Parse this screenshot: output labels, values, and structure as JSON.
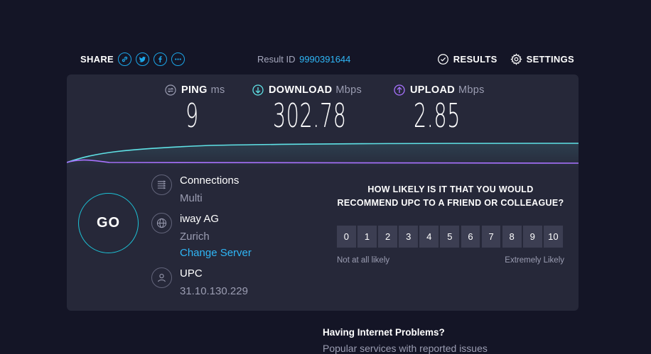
{
  "share": {
    "label": "SHARE",
    "icons": [
      "link-icon",
      "twitter-icon",
      "facebook-icon",
      "more-icon"
    ]
  },
  "result": {
    "label": "Result ID",
    "id": "9990391644"
  },
  "nav": {
    "results": "RESULTS",
    "settings": "SETTINGS"
  },
  "metrics": {
    "ping": {
      "label": "PING",
      "unit": "ms",
      "value": "9"
    },
    "download": {
      "label": "DOWNLOAD",
      "unit": "Mbps",
      "value": "302.78"
    },
    "upload": {
      "label": "UPLOAD",
      "unit": "Mbps",
      "value": "2.85"
    }
  },
  "colors": {
    "accent": "#1ca6e8",
    "download": "#5fe2e6",
    "upload": "#a872ff",
    "go_ring": "#1dc2d6"
  },
  "go": "GO",
  "connections": {
    "title": "Connections",
    "value": "Multi"
  },
  "server": {
    "name": "iway AG",
    "location": "Zurich",
    "change": "Change Server"
  },
  "user": {
    "isp": "UPC",
    "ip": "31.10.130.229"
  },
  "survey": {
    "question": "HOW LIKELY IS IT THAT YOU WOULD RECOMMEND UPC TO A FRIEND OR COLLEAGUE?",
    "options": [
      "0",
      "1",
      "2",
      "3",
      "4",
      "5",
      "6",
      "7",
      "8",
      "9",
      "10"
    ],
    "low_label": "Not at all likely",
    "high_label": "Extremely Likely"
  },
  "problems": {
    "title": "Having Internet Problems?",
    "subtitle": "Popular services with reported issues"
  }
}
